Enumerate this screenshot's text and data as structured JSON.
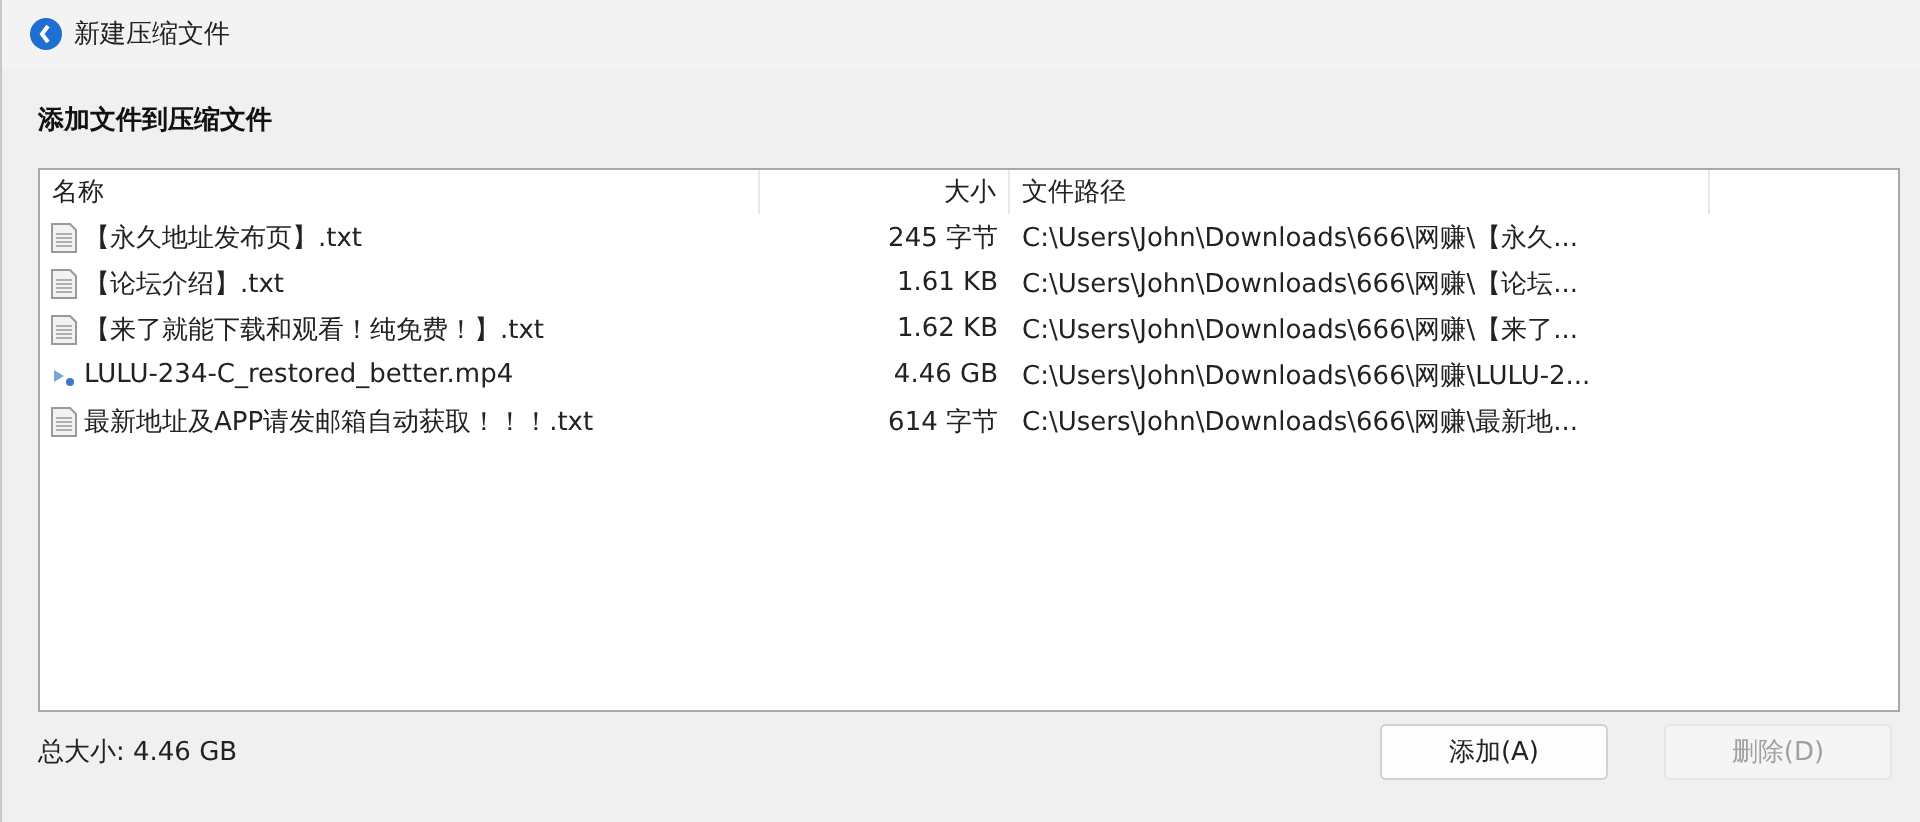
{
  "window": {
    "title": "新建压缩文件"
  },
  "heading": "添加文件到压缩文件",
  "table": {
    "columns": [
      {
        "label": "名称"
      },
      {
        "label": "大小"
      },
      {
        "label": "文件路径"
      }
    ],
    "rows": [
      {
        "kind": "text",
        "name": "【永久地址发布页】.txt",
        "size": "245 字节",
        "path": "C:\\Users\\John\\Downloads\\666\\网赚\\【永久..."
      },
      {
        "kind": "text",
        "name": "【论坛介绍】.txt",
        "size": "1.61 KB",
        "path": "C:\\Users\\John\\Downloads\\666\\网赚\\【论坛..."
      },
      {
        "kind": "text",
        "name": "【来了就能下载和观看！纯免费！】.txt",
        "size": "1.62 KB",
        "path": "C:\\Users\\John\\Downloads\\666\\网赚\\【来了..."
      },
      {
        "kind": "video",
        "name": "LULU-234-C_restored_better.mp4",
        "size": "4.46 GB",
        "path": "C:\\Users\\John\\Downloads\\666\\网赚\\LULU-2..."
      },
      {
        "kind": "text",
        "name": "最新地址及APP请发邮箱自动获取！！！.txt",
        "size": "614 字节",
        "path": "C:\\Users\\John\\Downloads\\666\\网赚\\最新地..."
      }
    ]
  },
  "total": "总大小: 4.46 GB",
  "buttons": [
    {
      "label": "添加(A)",
      "disabled": false
    },
    {
      "label": "删除(D)",
      "disabled": true
    }
  ]
}
